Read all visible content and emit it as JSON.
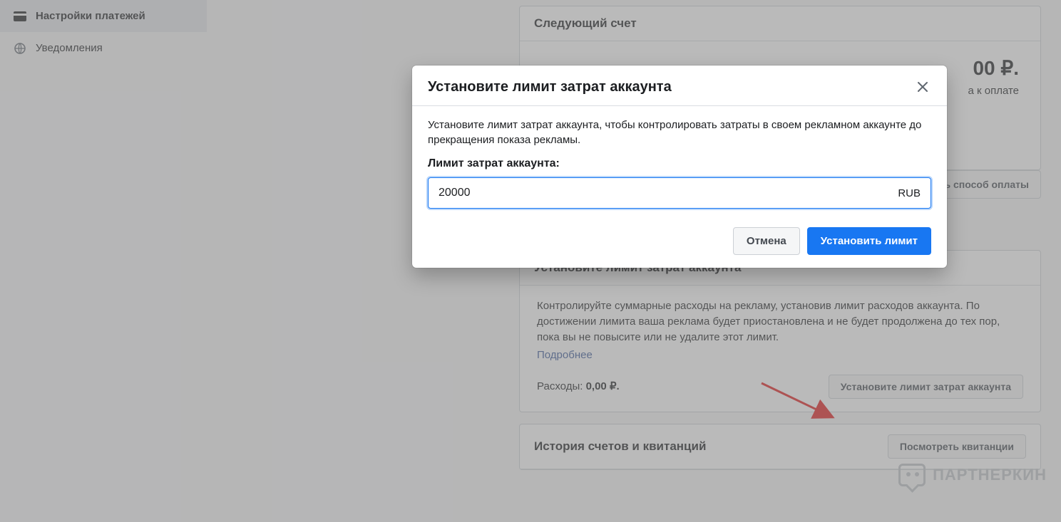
{
  "sidebar": {
    "items": [
      {
        "label": "Настройки платежей"
      },
      {
        "label": "Уведомления"
      }
    ]
  },
  "cards": {
    "next_bill": {
      "header": "Следующий счет",
      "amount_fragment": "00 ₽.",
      "sub_fragment": "а к оплате",
      "payment_method_button_fragment": "ь способ оплаты"
    },
    "spend_limit": {
      "header": "Установите лимит затрат аккаунта",
      "body": "Контролируйте суммарные расходы на рекламу, установив лимит расходов аккаунта. По достижении лимита ваша реклама будет приостановлена и не будет продолжена до тех пор, пока вы не повысите или не удалите этот лимит.",
      "learn_more": "Подробнее",
      "spend_label": "Расходы:",
      "spend_value": "0,00 ₽.",
      "button": "Установите лимит затрат аккаунта"
    },
    "history": {
      "header": "История счетов и квитанций",
      "button": "Посмотреть квитанции"
    }
  },
  "modal": {
    "title": "Установите лимит затрат аккаунта",
    "description": "Установите лимит затрат аккаунта, чтобы контролировать затраты в своем рекламном аккаунте до прекращения показа рекламы.",
    "input_label": "Лимит затрат аккаунта:",
    "input_value": "20000",
    "currency": "RUB",
    "cancel": "Отмена",
    "confirm": "Установить лимит"
  },
  "watermark": "ПАРТНЕРКИН"
}
